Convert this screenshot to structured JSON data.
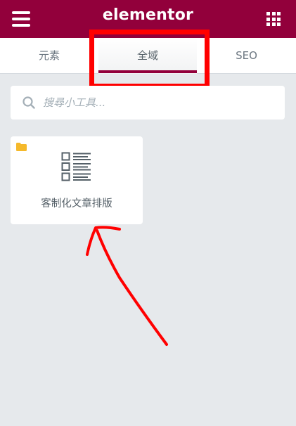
{
  "header": {
    "brand": "elementor",
    "menu_icon": "hamburger-icon",
    "apps_icon": "grid-icon",
    "bg_color": "#92003b"
  },
  "tabs": [
    {
      "label": "元素",
      "active": false
    },
    {
      "label": "全域",
      "active": true
    },
    {
      "label": "SEO",
      "active": false
    }
  ],
  "search": {
    "placeholder": "搜尋小工具...",
    "value": "",
    "icon": "search-icon"
  },
  "widgets": [
    {
      "label": "客制化文章排版",
      "icon": "post-list-icon",
      "badge_icon": "folder-icon",
      "badge_color": "#f5b92b"
    }
  ],
  "annotations": {
    "highlight_color": "#ff0000"
  }
}
